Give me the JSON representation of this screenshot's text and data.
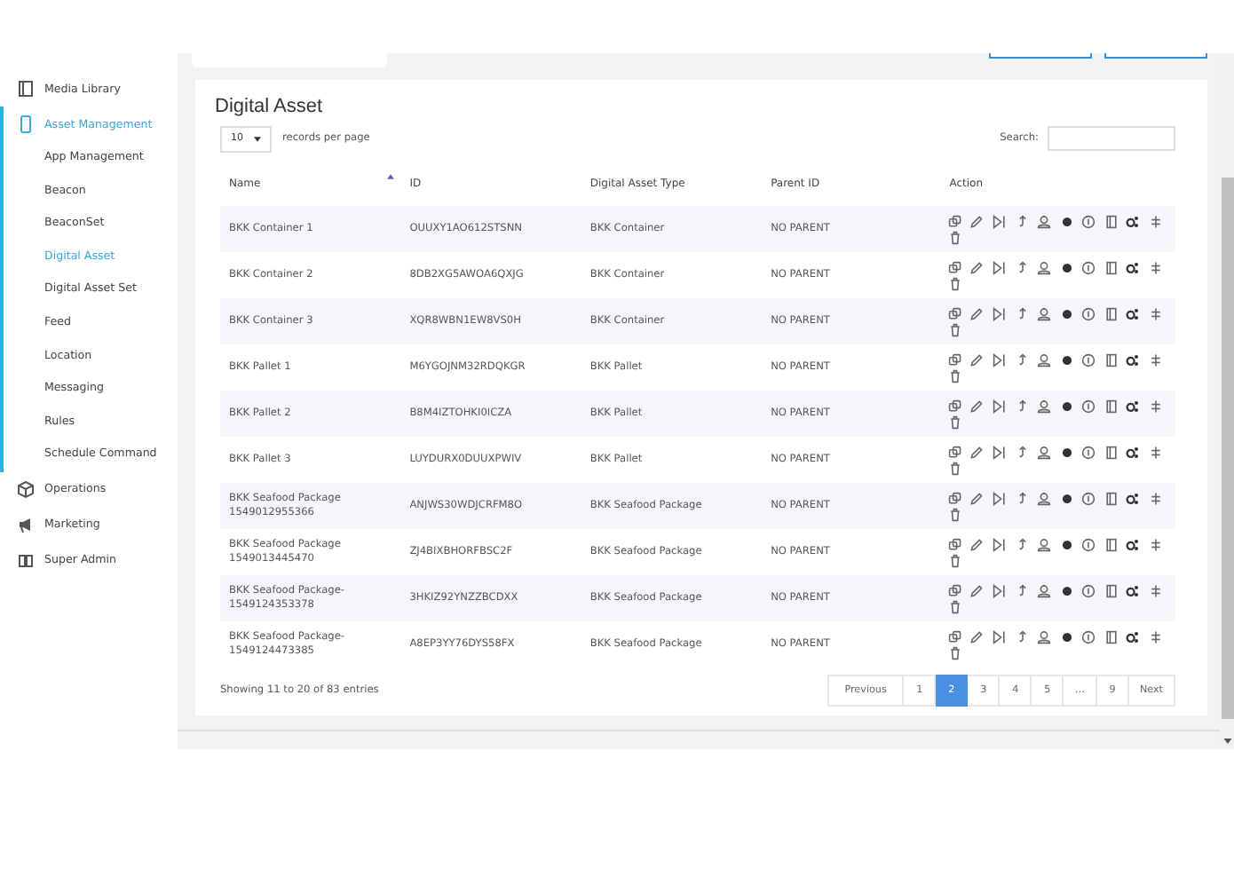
{
  "sidebar": {
    "items": [
      {
        "label": "Media Library",
        "selected": false
      },
      {
        "label": "Asset Management",
        "selected": true,
        "children": [
          {
            "label": "App Management",
            "selected": false
          },
          {
            "label": "Beacon",
            "selected": false
          },
          {
            "label": "BeaconSet",
            "selected": false
          },
          {
            "label": "Digital Asset",
            "selected": true
          },
          {
            "label": "Digital Asset Set",
            "selected": false
          },
          {
            "label": "Feed",
            "selected": false
          },
          {
            "label": "Location",
            "selected": false
          },
          {
            "label": "Messaging",
            "selected": false
          },
          {
            "label": "Rules",
            "selected": false
          },
          {
            "label": "Schedule Command",
            "selected": false
          }
        ]
      },
      {
        "label": "Operations",
        "selected": false
      },
      {
        "label": "Marketing",
        "selected": false
      },
      {
        "label": "Super Admin",
        "selected": false
      }
    ]
  },
  "panel": {
    "title": "Digital Asset",
    "page_length": "10",
    "page_length_label": "records per page",
    "search_label": "Search:",
    "table": {
      "columns": [
        {
          "label": "Name",
          "sorted": true
        },
        {
          "label": "ID",
          "sorted": false
        },
        {
          "label": "Digital Asset Type",
          "sorted": false
        },
        {
          "label": "Parent ID",
          "sorted": false
        },
        {
          "label": "Action",
          "sorted": false
        }
      ],
      "rows": [
        [
          "BKK Container 1",
          "OUUXY1AO612STSNN",
          "BKK Container",
          "NO PARENT"
        ],
        [
          "BKK Container 2",
          "8DB2XG5AWOA6QXJG",
          "BKK Container",
          "NO PARENT"
        ],
        [
          "BKK Container 3",
          "XQR8WBN1EW8VS0H",
          "BKK Container",
          "NO PARENT"
        ],
        [
          "BKK Pallet 1",
          "M6YGOJNM32RDQKGR",
          "BKK Pallet",
          "NO PARENT"
        ],
        [
          "BKK Pallet 2",
          "B8M4IZTOHKI0ICZA",
          "BKK Pallet",
          "NO PARENT"
        ],
        [
          "BKK Pallet 3",
          "LUYDURX0DUUXPWIV",
          "BKK Pallet",
          "NO PARENT"
        ],
        [
          "BKK Seafood Package 1549012955366",
          "ANJWS30WDJCRFM8O",
          "BKK Seafood Package",
          "NO PARENT"
        ],
        [
          "BKK Seafood Package 1549013445470",
          "ZJ4BIXBHORFBSC2F",
          "BKK Seafood Package",
          "NO PARENT"
        ],
        [
          "BKK Seafood Package-1549124353378",
          "3HKIZ92YNZZBCDXX",
          "BKK Seafood Package",
          "NO PARENT"
        ],
        [
          "BKK Seafood Package-1549124473385",
          "A8EP3YY76DYS58FX",
          "BKK Seafood Package",
          "NO PARENT"
        ]
      ]
    },
    "info": "Showing 11 to 20 of 83 entries",
    "pagination": [
      {
        "label": "Previous",
        "selected": false
      },
      {
        "label": "1",
        "selected": false
      },
      {
        "label": "2",
        "selected": true
      },
      {
        "label": "3",
        "selected": false
      },
      {
        "label": "4",
        "selected": false
      },
      {
        "label": "5",
        "selected": false
      },
      {
        "label": "…",
        "selected": false
      },
      {
        "label": "9",
        "selected": false
      },
      {
        "label": "Next",
        "selected": false
      }
    ]
  }
}
